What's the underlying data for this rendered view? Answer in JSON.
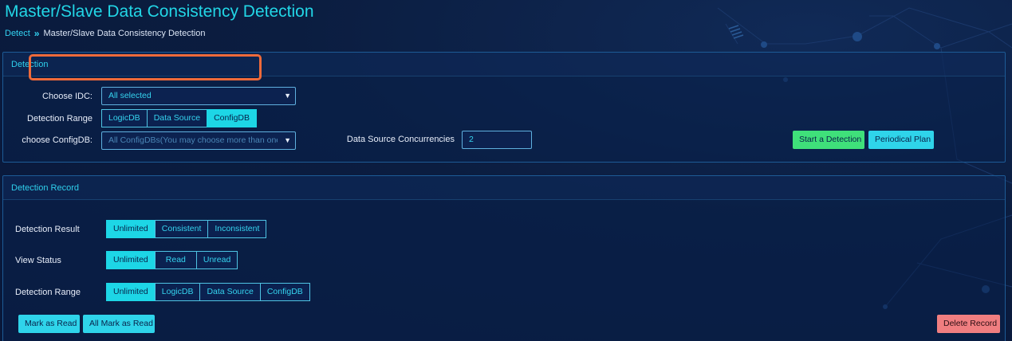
{
  "page": {
    "title": "Master/Slave Data Consistency Detection"
  },
  "breadcrumb": {
    "link": "Detect",
    "current": "Master/Slave Data Consistency Detection"
  },
  "detection": {
    "header": "Detection",
    "idc": {
      "label": "Choose IDC:",
      "value": "All selected"
    },
    "range": {
      "label": "Detection Range",
      "options": [
        "LogicDB",
        "Data Source",
        "ConfigDB"
      ],
      "selected": "ConfigDB"
    },
    "configdb": {
      "label": "choose ConfigDB:",
      "placeholder": "All ConfigDBs(You may choose more than one ConfigDB)"
    },
    "concurrency": {
      "label": "Data Source Concurrencies",
      "value": "2"
    },
    "start_label": "Start a Detection",
    "plan_label": "Periodical Plan"
  },
  "record": {
    "header": "Detection Record",
    "result": {
      "label": "Detection Result",
      "options": [
        "Unlimited",
        "Consistent",
        "Inconsistent"
      ],
      "selected": "Unlimited"
    },
    "view_status": {
      "label": "View Status",
      "options": [
        "Unlimited",
        "Read",
        "Unread"
      ],
      "selected": "Unlimited"
    },
    "range": {
      "label": "Detection Range",
      "options": [
        "Unlimited",
        "LogicDB",
        "Data Source",
        "ConfigDB"
      ],
      "selected": "Unlimited"
    },
    "mark_read_label": "Mark as Read",
    "all_mark_read_label": "All Mark as Read",
    "delete_label": "Delete Record"
  },
  "icons": {
    "dropdown": "chevron-down-icon",
    "breadcrumb_separator": "double-chevron-right-icon"
  },
  "colors": {
    "accent": "#22d6e6",
    "active_segment": "#1dd6e6",
    "start_button": "#3fe07a",
    "delete_button": "#f07e80",
    "highlight": "#ee6a3a"
  }
}
